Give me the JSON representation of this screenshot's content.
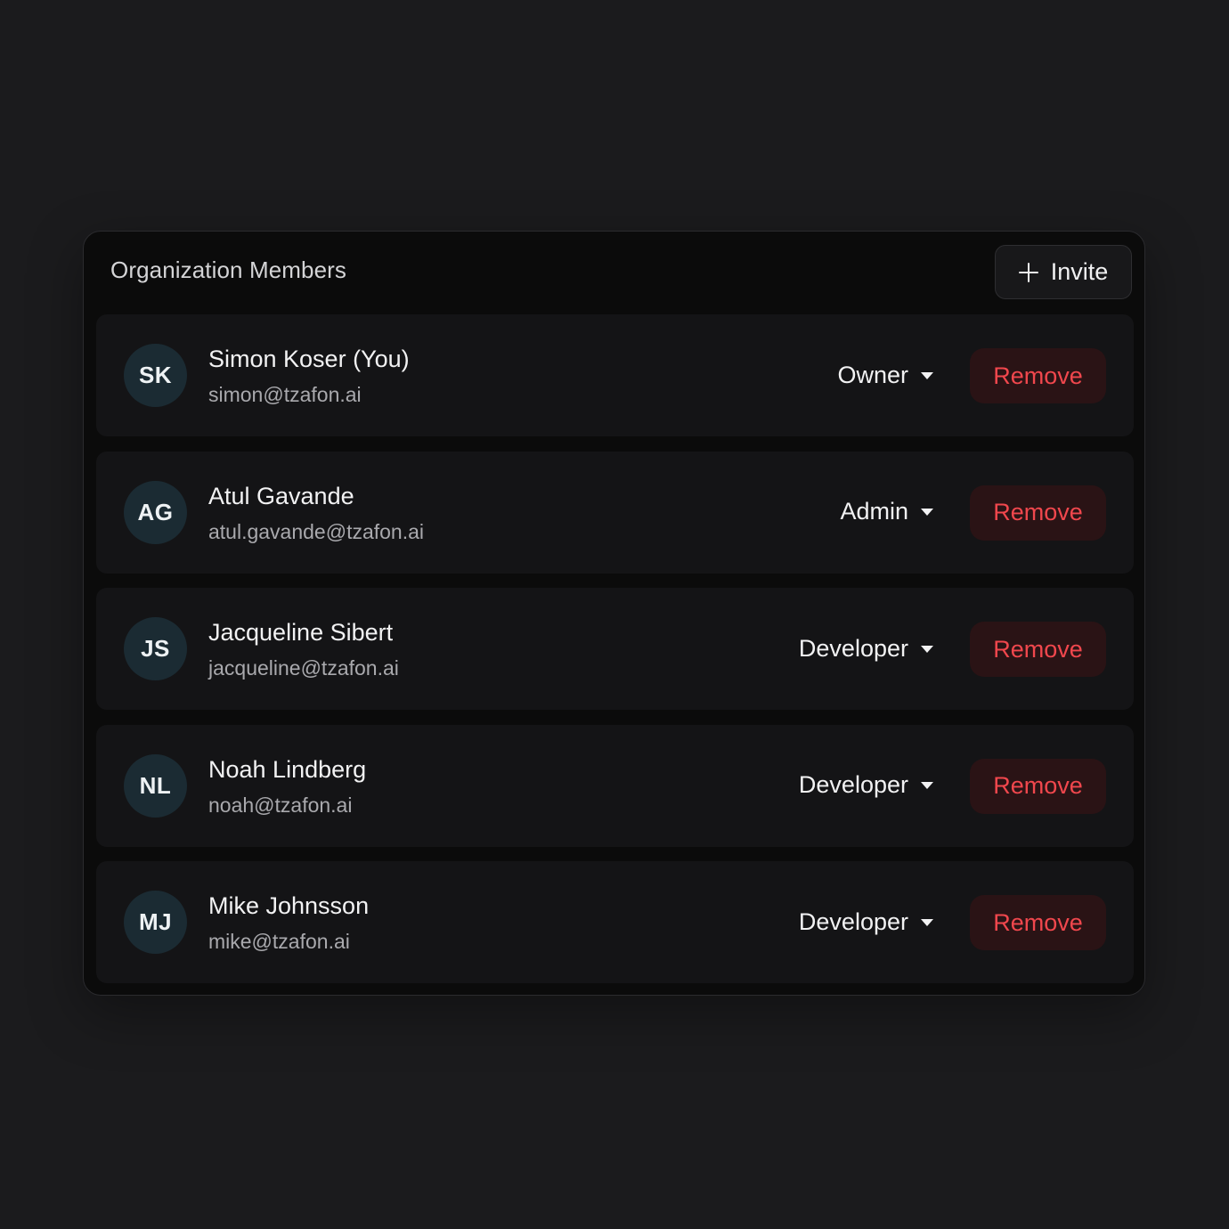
{
  "panel": {
    "title": "Organization Members",
    "invite_label": "Invite"
  },
  "members": [
    {
      "initials": "SK",
      "name": "Simon Koser (You)",
      "email": "simon@tzafon.ai",
      "role": "Owner",
      "remove_label": "Remove"
    },
    {
      "initials": "AG",
      "name": "Atul Gavande",
      "email": "atul.gavande@tzafon.ai",
      "role": "Admin",
      "remove_label": "Remove"
    },
    {
      "initials": "JS",
      "name": "Jacqueline Sibert",
      "email": "jacqueline@tzafon.ai",
      "role": "Developer",
      "remove_label": "Remove"
    },
    {
      "initials": "NL",
      "name": "Noah Lindberg",
      "email": "noah@tzafon.ai",
      "role": "Developer",
      "remove_label": "Remove"
    },
    {
      "initials": "MJ",
      "name": "Mike Johnsson",
      "email": "mike@tzafon.ai",
      "role": "Developer",
      "remove_label": "Remove"
    }
  ],
  "icons": {
    "invite": "plus-icon",
    "role_dropdown": "caret-down-icon"
  },
  "colors": {
    "background": "#1b1b1d",
    "panel": "#0b0b0b",
    "row": "#141416",
    "avatar": "#1b2b33",
    "remove_text": "#f0474d",
    "remove_bg": "#2a1315"
  }
}
